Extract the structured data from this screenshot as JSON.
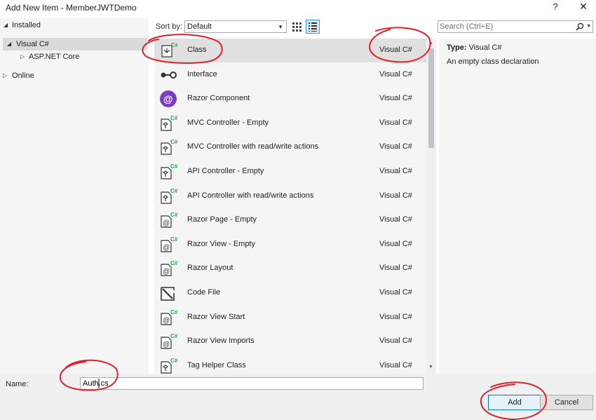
{
  "window": {
    "title": "Add New Item - MemberJWTDemo",
    "help_label": "?",
    "close_label": "✕"
  },
  "tree": {
    "installed_label": "Installed",
    "visual_csharp_label": "Visual C#",
    "aspnet_core_label": "ASP.NET Core",
    "online_label": "Online"
  },
  "toolbar": {
    "sort_label": "Sort by:",
    "sort_value": "Default"
  },
  "search": {
    "placeholder": "Search (Ctrl+E)"
  },
  "templates": [
    {
      "name": "Class",
      "language": "Visual C#",
      "icon": "class-icon"
    },
    {
      "name": "Interface",
      "language": "Visual C#",
      "icon": "interface-icon"
    },
    {
      "name": "Razor Component",
      "language": "Visual C#",
      "icon": "razor-component-icon"
    },
    {
      "name": "MVC Controller - Empty",
      "language": "Visual C#",
      "icon": "controller-icon"
    },
    {
      "name": "MVC Controller with read/write actions",
      "language": "Visual C#",
      "icon": "controller-icon"
    },
    {
      "name": "API Controller - Empty",
      "language": "Visual C#",
      "icon": "controller-icon"
    },
    {
      "name": "API Controller with read/write actions",
      "language": "Visual C#",
      "icon": "controller-icon"
    },
    {
      "name": "Razor Page - Empty",
      "language": "Visual C#",
      "icon": "razor-page-icon"
    },
    {
      "name": "Razor View - Empty",
      "language": "Visual C#",
      "icon": "razor-page-icon"
    },
    {
      "name": "Razor Layout",
      "language": "Visual C#",
      "icon": "razor-page-icon"
    },
    {
      "name": "Code File",
      "language": "Visual C#",
      "icon": "code-file-icon"
    },
    {
      "name": "Razor View Start",
      "language": "Visual C#",
      "icon": "razor-page-icon"
    },
    {
      "name": "Razor View Imports",
      "language": "Visual C#",
      "icon": "razor-page-icon"
    },
    {
      "name": "Tag Helper Class",
      "language": "Visual C#",
      "icon": "controller-icon"
    }
  ],
  "detail": {
    "type_label": "Type:",
    "type_value": "Visual C#",
    "description": "An empty class declaration"
  },
  "name_field": {
    "label": "Name:",
    "value": "Auth.cs"
  },
  "buttons": {
    "add_label": "Add",
    "cancel_label": "Cancel"
  },
  "colors": {
    "accent": "#0078d7",
    "selected_row": "#e0e0e0",
    "annotation": "#e0202a",
    "csharp_green": "#2e9e3f"
  }
}
